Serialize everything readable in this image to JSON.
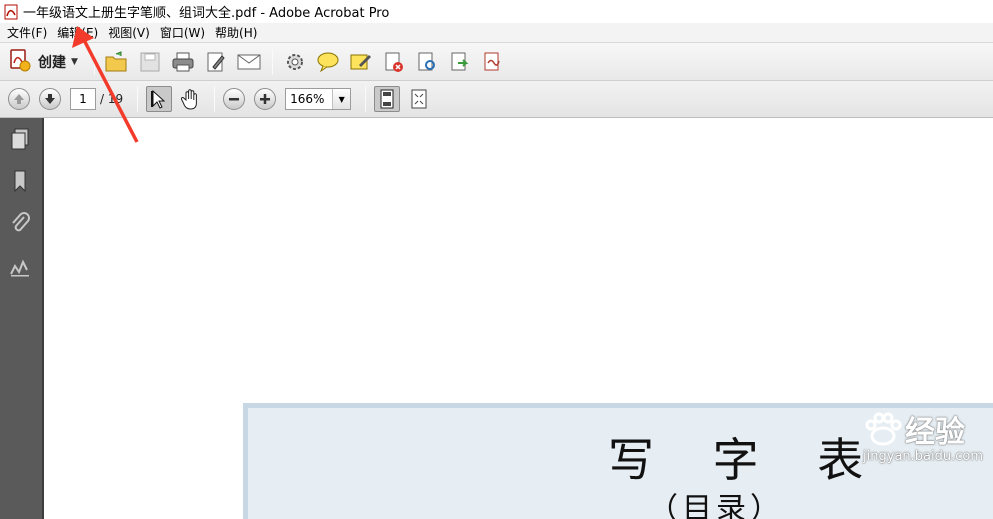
{
  "window": {
    "title": "一年级语文上册生字笔顺、组词大全.pdf - Adobe Acrobat Pro"
  },
  "menu": [
    {
      "label": "文件(F)"
    },
    {
      "label": "编辑(E)"
    },
    {
      "label": "视图(V)"
    },
    {
      "label": "窗口(W)"
    },
    {
      "label": "帮助(H)"
    }
  ],
  "toolbar": {
    "create_label": "创建",
    "icons": [
      "open-folder-icon",
      "save-icon",
      "print-icon",
      "edit-doc-icon",
      "email-icon",
      "settings-gear-icon",
      "comment-icon",
      "highlight-icon",
      "delete-doc-icon",
      "attach-doc-icon",
      "export-icon",
      "sign-icon"
    ]
  },
  "navigation": {
    "current_page": "1",
    "total_pages": "/ 19",
    "zoom": "166%"
  },
  "sidebar": {
    "icons": [
      "pages-icon",
      "bookmark-icon",
      "attachment-clip-icon",
      "signature-icon"
    ]
  },
  "document": {
    "heading": "写 字 表",
    "subheading": "（目录）"
  },
  "watermark": {
    "text": "经验",
    "url": "jingyan.baidu.com"
  },
  "colors": {
    "sidebar_bg": "#5a5a5a",
    "page_box_bg": "#e6eef3",
    "annotation_arrow": "#f23b2a"
  }
}
